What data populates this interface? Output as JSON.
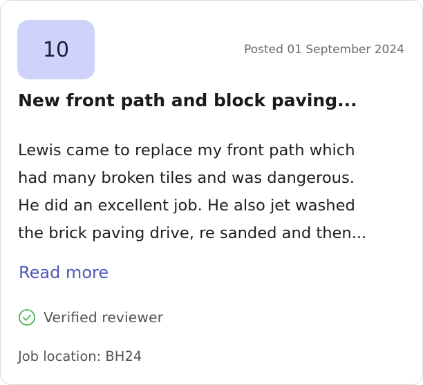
{
  "review": {
    "score": "10",
    "posted": "Posted 01 September 2024",
    "title": "New front path and block paving...",
    "body_lines": [
      "Lewis came to replace my front path which",
      "had many broken tiles and was dangerous.",
      "He did an excellent job. He also jet washed",
      "the brick paving drive, re sanded and then..."
    ],
    "read_more": "Read more",
    "verified_label": "Verified reviewer",
    "job_location": "Job location: BH24"
  },
  "colors": {
    "badge_bg": "#cfd3fb",
    "link": "#4f58b8",
    "verified_icon": "#4caf50"
  },
  "icons": {
    "verified": "check-circle-icon"
  }
}
